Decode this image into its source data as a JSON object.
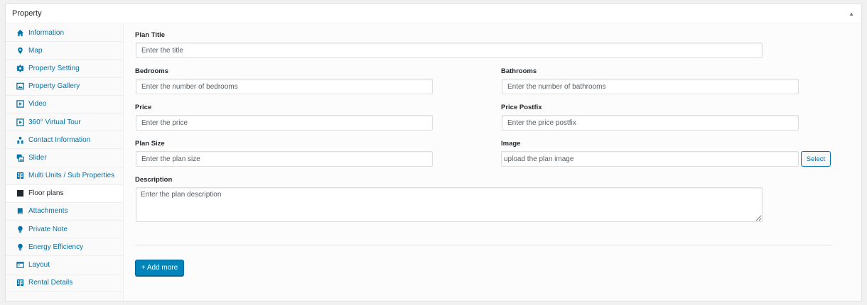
{
  "box": {
    "title": "Property",
    "toggle_icon": "▲"
  },
  "sidebar": {
    "tabs": [
      {
        "label": "Information",
        "icon": "home-icon"
      },
      {
        "label": "Map",
        "icon": "location-pin-icon"
      },
      {
        "label": "Property Setting",
        "icon": "gear-icon"
      },
      {
        "label": "Property Gallery",
        "icon": "gallery-icon"
      },
      {
        "label": "Video",
        "icon": "video-icon"
      },
      {
        "label": "360° Virtual Tour",
        "icon": "video-icon"
      },
      {
        "label": "Contact Information",
        "icon": "users-icon"
      },
      {
        "label": "Slider",
        "icon": "images-icon"
      },
      {
        "label": "Multi Units / Sub Properties",
        "icon": "building-icon"
      },
      {
        "label": "Floor plans",
        "icon": "building-icon",
        "active": true
      },
      {
        "label": "Attachments",
        "icon": "book-icon"
      },
      {
        "label": "Private Note",
        "icon": "lightbulb-icon"
      },
      {
        "label": "Energy Efficiency",
        "icon": "lightbulb-icon"
      },
      {
        "label": "Layout",
        "icon": "layout-icon"
      },
      {
        "label": "Rental Details",
        "icon": "building-icon"
      }
    ]
  },
  "form": {
    "plan_title": {
      "label": "Plan Title",
      "placeholder": "Enter the title",
      "value": ""
    },
    "bedrooms": {
      "label": "Bedrooms",
      "placeholder": "Enter the number of bedrooms",
      "value": ""
    },
    "bathrooms": {
      "label": "Bathrooms",
      "placeholder": "Enter the number of bathrooms",
      "value": ""
    },
    "price": {
      "label": "Price",
      "placeholder": "Enter the price",
      "value": ""
    },
    "price_postfix": {
      "label": "Price Postfix",
      "placeholder": "Enter the price postfix",
      "value": ""
    },
    "plan_size": {
      "label": "Plan Size",
      "placeholder": "Enter the plan size",
      "value": ""
    },
    "image": {
      "label": "Image",
      "placeholder": "upload the plan image",
      "value": "",
      "select_label": "Select"
    },
    "description": {
      "label": "Description",
      "placeholder": "Enter the plan description",
      "value": ""
    }
  },
  "actions": {
    "add_more_label": "+ Add more"
  },
  "colors": {
    "link": "#0073aa",
    "primary_button": "#0085ba"
  }
}
